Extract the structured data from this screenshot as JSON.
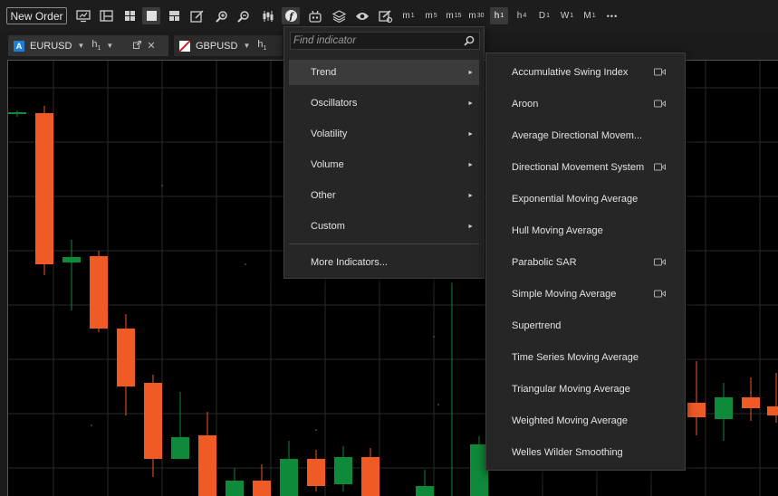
{
  "toolbar": {
    "new_order_label": "New Order",
    "timeframes": [
      {
        "base": "m",
        "sub": "1"
      },
      {
        "base": "m",
        "sub": "5"
      },
      {
        "base": "m",
        "sub": "15"
      },
      {
        "base": "m",
        "sub": "30"
      },
      {
        "base": "h",
        "sub": "1"
      },
      {
        "base": "h",
        "sub": "4"
      },
      {
        "base": "D",
        "sub": "1"
      },
      {
        "base": "W",
        "sub": "1"
      },
      {
        "base": "M",
        "sub": "1"
      }
    ],
    "more_label": "•••"
  },
  "tabs": [
    {
      "symbol": "EURUSD",
      "badge": "A",
      "period_base": "h",
      "period_sub": "1"
    },
    {
      "symbol": "GBPUSD",
      "badge": "",
      "period_base": "h",
      "period_sub": "1"
    }
  ],
  "indicator_menu": {
    "search_placeholder": "Find indicator",
    "categories": [
      "Trend",
      "Oscillators",
      "Volatility",
      "Volume",
      "Other",
      "Custom"
    ],
    "active_category": "Trend",
    "more_label": "More Indicators..."
  },
  "trend_indicators": [
    {
      "label": "Accumulative Swing Index",
      "video": true
    },
    {
      "label": "Aroon",
      "video": true
    },
    {
      "label": "Average Directional Movem...",
      "video": false
    },
    {
      "label": "Directional Movement System",
      "video": true
    },
    {
      "label": "Exponential Moving Average",
      "video": false
    },
    {
      "label": "Hull Moving Average",
      "video": false
    },
    {
      "label": "Parabolic SAR",
      "video": true
    },
    {
      "label": "Simple Moving Average",
      "video": true
    },
    {
      "label": "Supertrend",
      "video": false
    },
    {
      "label": "Time Series Moving Average",
      "video": false
    },
    {
      "label": "Triangular Moving Average",
      "video": false
    },
    {
      "label": "Weighted Moving Average",
      "video": false
    },
    {
      "label": "Welles Wilder Smoothing",
      "video": false
    }
  ],
  "colors": {
    "bearish": "#f05a24",
    "bullish": "#0f8a3a",
    "grid": "#2a2a2a",
    "background": "#000000",
    "menu_background": "#262626",
    "menu_active": "#3b3b3b"
  }
}
